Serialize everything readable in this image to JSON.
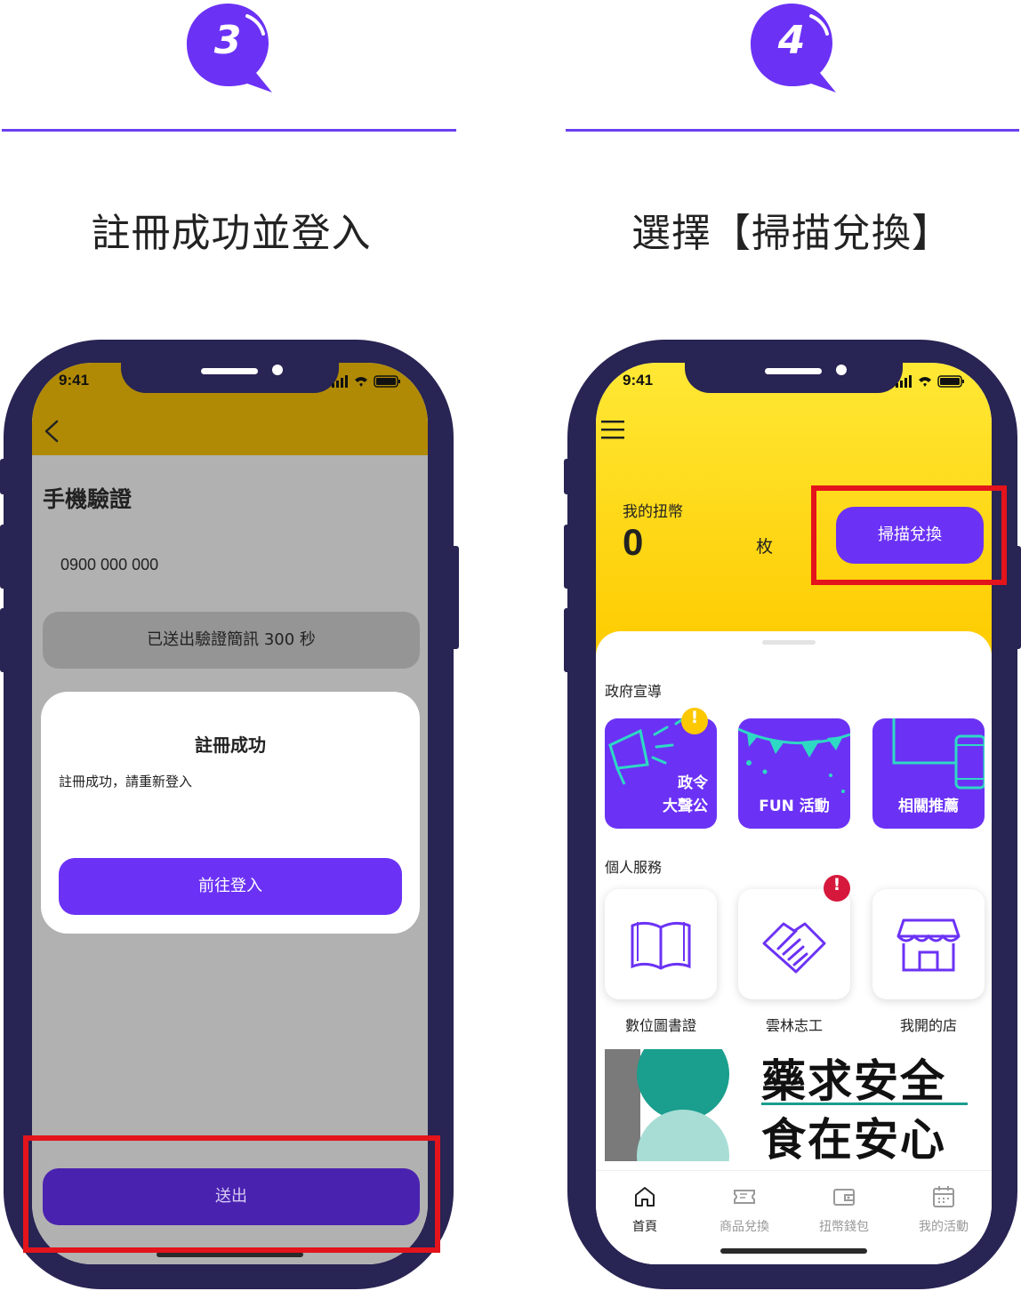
{
  "steps": [
    {
      "number": "3",
      "title": "註冊成功並登入"
    },
    {
      "number": "4",
      "title": "選擇【掃描兌換】"
    }
  ],
  "colors": {
    "accent": "#6b32f5",
    "highlight": "#e3141b",
    "phone_frame": "#282453",
    "header_yellow": "#fecb00"
  },
  "status_bar": {
    "time": "9:41"
  },
  "left_phone": {
    "page_title": "手機驗證",
    "phone_number": "0900 000 000",
    "sent_button": "已送出驗證簡訊 300 秒",
    "dialog": {
      "title": "註冊成功",
      "message": "註冊成功，請重新登入",
      "button": "前往登入"
    },
    "submit_button": "送出"
  },
  "right_phone": {
    "coins": {
      "label": "我的扭幣",
      "value": "0",
      "unit": "枚"
    },
    "scan_button": "掃描兌換",
    "gov_section": {
      "title": "政府宣導",
      "cards": [
        {
          "label": "政令\n大聲公",
          "icon": "megaphone-icon"
        },
        {
          "label": "FUN 活動",
          "icon": "bunting-icon"
        },
        {
          "label": "相關推薦",
          "icon": "devices-icon"
        }
      ]
    },
    "personal_section": {
      "title": "個人服務",
      "items": [
        {
          "label": "數位圖書證",
          "icon": "book-icon"
        },
        {
          "label": "雲林志工",
          "icon": "handshake-icon"
        },
        {
          "label": "我開的店",
          "icon": "store-icon"
        }
      ]
    },
    "banner": {
      "line1": "藥求安全",
      "line2": "食在安心"
    },
    "tabs": [
      {
        "label": "首頁",
        "icon": "home-icon",
        "active": true
      },
      {
        "label": "商品兌換",
        "icon": "ticket-icon",
        "active": false
      },
      {
        "label": "扭幣錢包",
        "icon": "wallet-icon",
        "active": false
      },
      {
        "label": "我的活動",
        "icon": "calendar-icon",
        "active": false
      }
    ]
  }
}
